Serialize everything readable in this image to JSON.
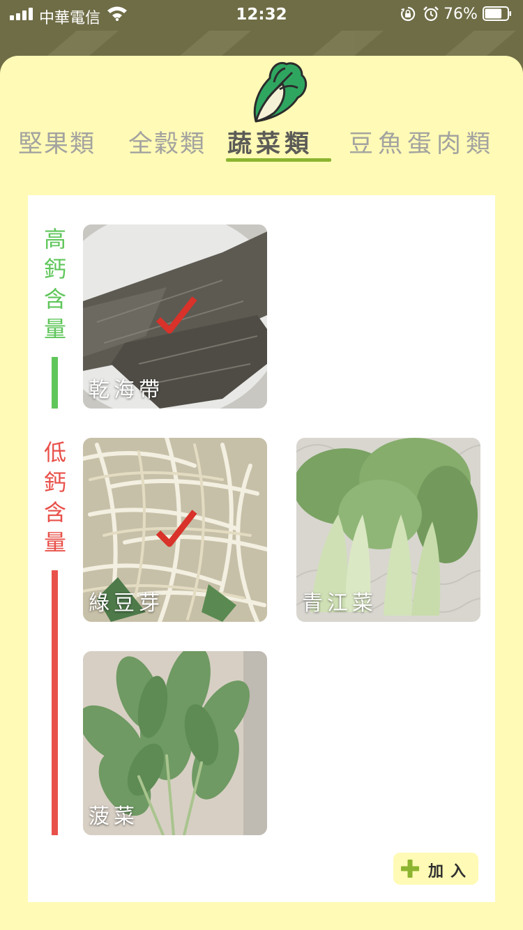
{
  "status_bar": {
    "carrier": "中華電信",
    "time": "12:32",
    "battery_percent": "76%",
    "battery_level": 0.76
  },
  "categories": {
    "tabs": [
      {
        "label": "堅果類",
        "active": false
      },
      {
        "label": "全穀類",
        "active": false
      },
      {
        "label": "蔬菜類",
        "active": true
      },
      {
        "label": "豆魚蛋肉類",
        "active": false
      }
    ],
    "active_icon": "cabbage-icon"
  },
  "sections": {
    "high_calcium": {
      "label": "高鈣含量",
      "color": "#5fc65a",
      "items": [
        {
          "name": "乾海帶",
          "checked": true
        }
      ]
    },
    "low_calcium": {
      "label": "低鈣含量",
      "color": "#e8514a",
      "items": [
        {
          "name": "綠豆芽",
          "checked": true
        },
        {
          "name": "青江菜",
          "checked": false
        },
        {
          "name": "菠菜",
          "checked": false
        }
      ]
    }
  },
  "add_button": {
    "label": "加入",
    "icon": "plus-icon",
    "accent": "#8cb430"
  },
  "colors": {
    "sheet_background": "#fffab5",
    "tab_underline": "#8cb430",
    "check_mark": "#d8322a"
  }
}
